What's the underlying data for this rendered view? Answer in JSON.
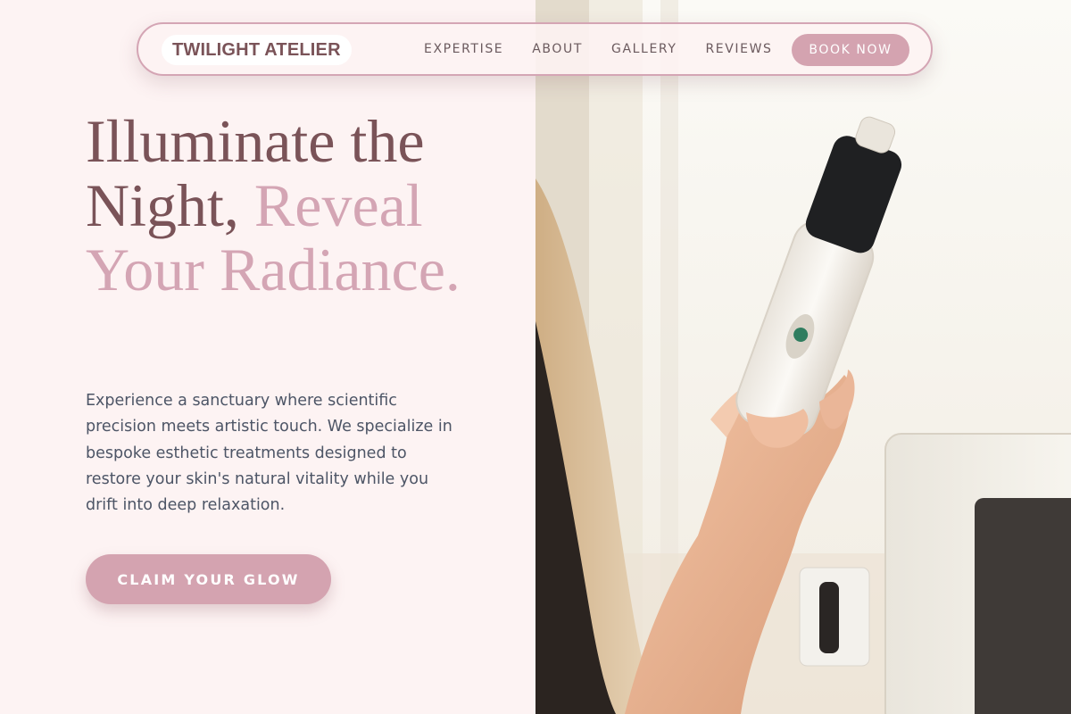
{
  "brand": {
    "name": "TWILIGHT ATELIER"
  },
  "nav": {
    "links": [
      {
        "label": "EXPERTISE"
      },
      {
        "label": "ABOUT"
      },
      {
        "label": "GALLERY"
      },
      {
        "label": "REVIEWS"
      }
    ],
    "cta_label": "BOOK NOW"
  },
  "hero": {
    "title_part1": "Illuminate the Night, ",
    "title_part2": "Reveal Your Radiance.",
    "description": "Experience a sanctuary where scientific precision meets artistic touch. We specialize in bespoke esthetic treatments designed to restore your skin's natural vitality while you drift into deep relaxation.",
    "cta_label": "CLAIM YOUR GLOW"
  },
  "colors": {
    "background": "#fdf3f3",
    "brand_mauve": "#7a5358",
    "accent_pink": "#d4a5b4",
    "body_text": "#4d5566"
  },
  "photo": {
    "subject": "hand holding esthetic treatment device",
    "icon": "photo-image"
  }
}
